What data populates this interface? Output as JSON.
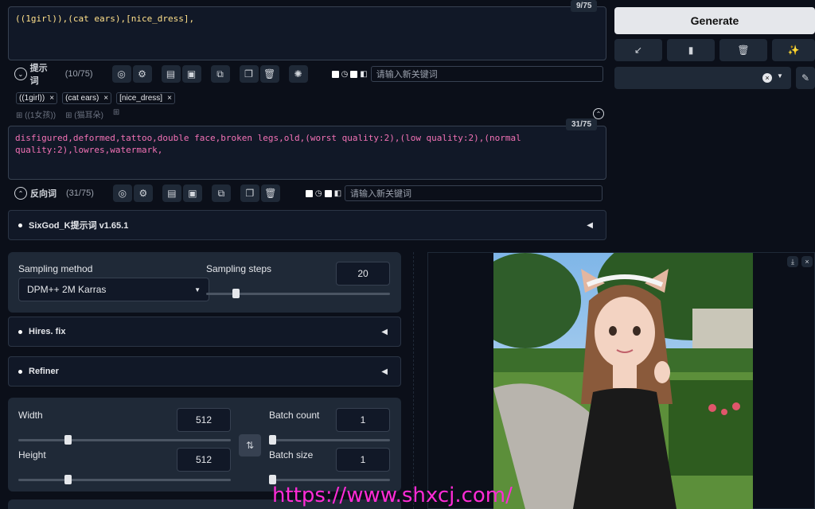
{
  "prompt": {
    "text": "((1girl)),(cat ears),[nice_dress],",
    "counter": "9/75",
    "toolbar_label": "提示词",
    "toolbar_count": "(10/75)",
    "search_placeholder": "请输入新关键词",
    "tags": [
      {
        "label": "((1girl))"
      },
      {
        "label": "(cat ears)"
      },
      {
        "label": "[nice_dress]"
      }
    ],
    "tag_translations": [
      "((1女孩))",
      "(猫耳朵)"
    ]
  },
  "negative": {
    "text": "disfigured,deformed,tattoo,double face,broken legs,old,(worst quality:2),(low quality:2),(normal quality:2),lowres,watermark,",
    "counter": "31/75",
    "toolbar_label": "反向词",
    "toolbar_count": "(31/75)",
    "search_placeholder": "请输入新关键词"
  },
  "extension": {
    "title": "SixGod_K提示词 v1.65.1"
  },
  "sampling": {
    "method_label": "Sampling method",
    "method_value": "DPM++ 2M Karras",
    "steps_label": "Sampling steps",
    "steps_value": "20",
    "steps_fraction": 0.15
  },
  "accordions": {
    "hires": "Hires. fix",
    "refiner": "Refiner"
  },
  "dimensions": {
    "width_label": "Width",
    "width_value": "512",
    "height_label": "Height",
    "height_value": "512",
    "batch_count_label": "Batch count",
    "batch_count_value": "1",
    "batch_size_label": "Batch size",
    "batch_size_value": "1"
  },
  "generate": {
    "label": "Generate"
  },
  "watermark": {
    "text": "https://www.shxcj.com/"
  },
  "colors": {
    "prompt_text": "#ffe08a",
    "negative_text": "#f472b6",
    "background": "#0b0f19",
    "watermark": "#ff2bd6"
  }
}
